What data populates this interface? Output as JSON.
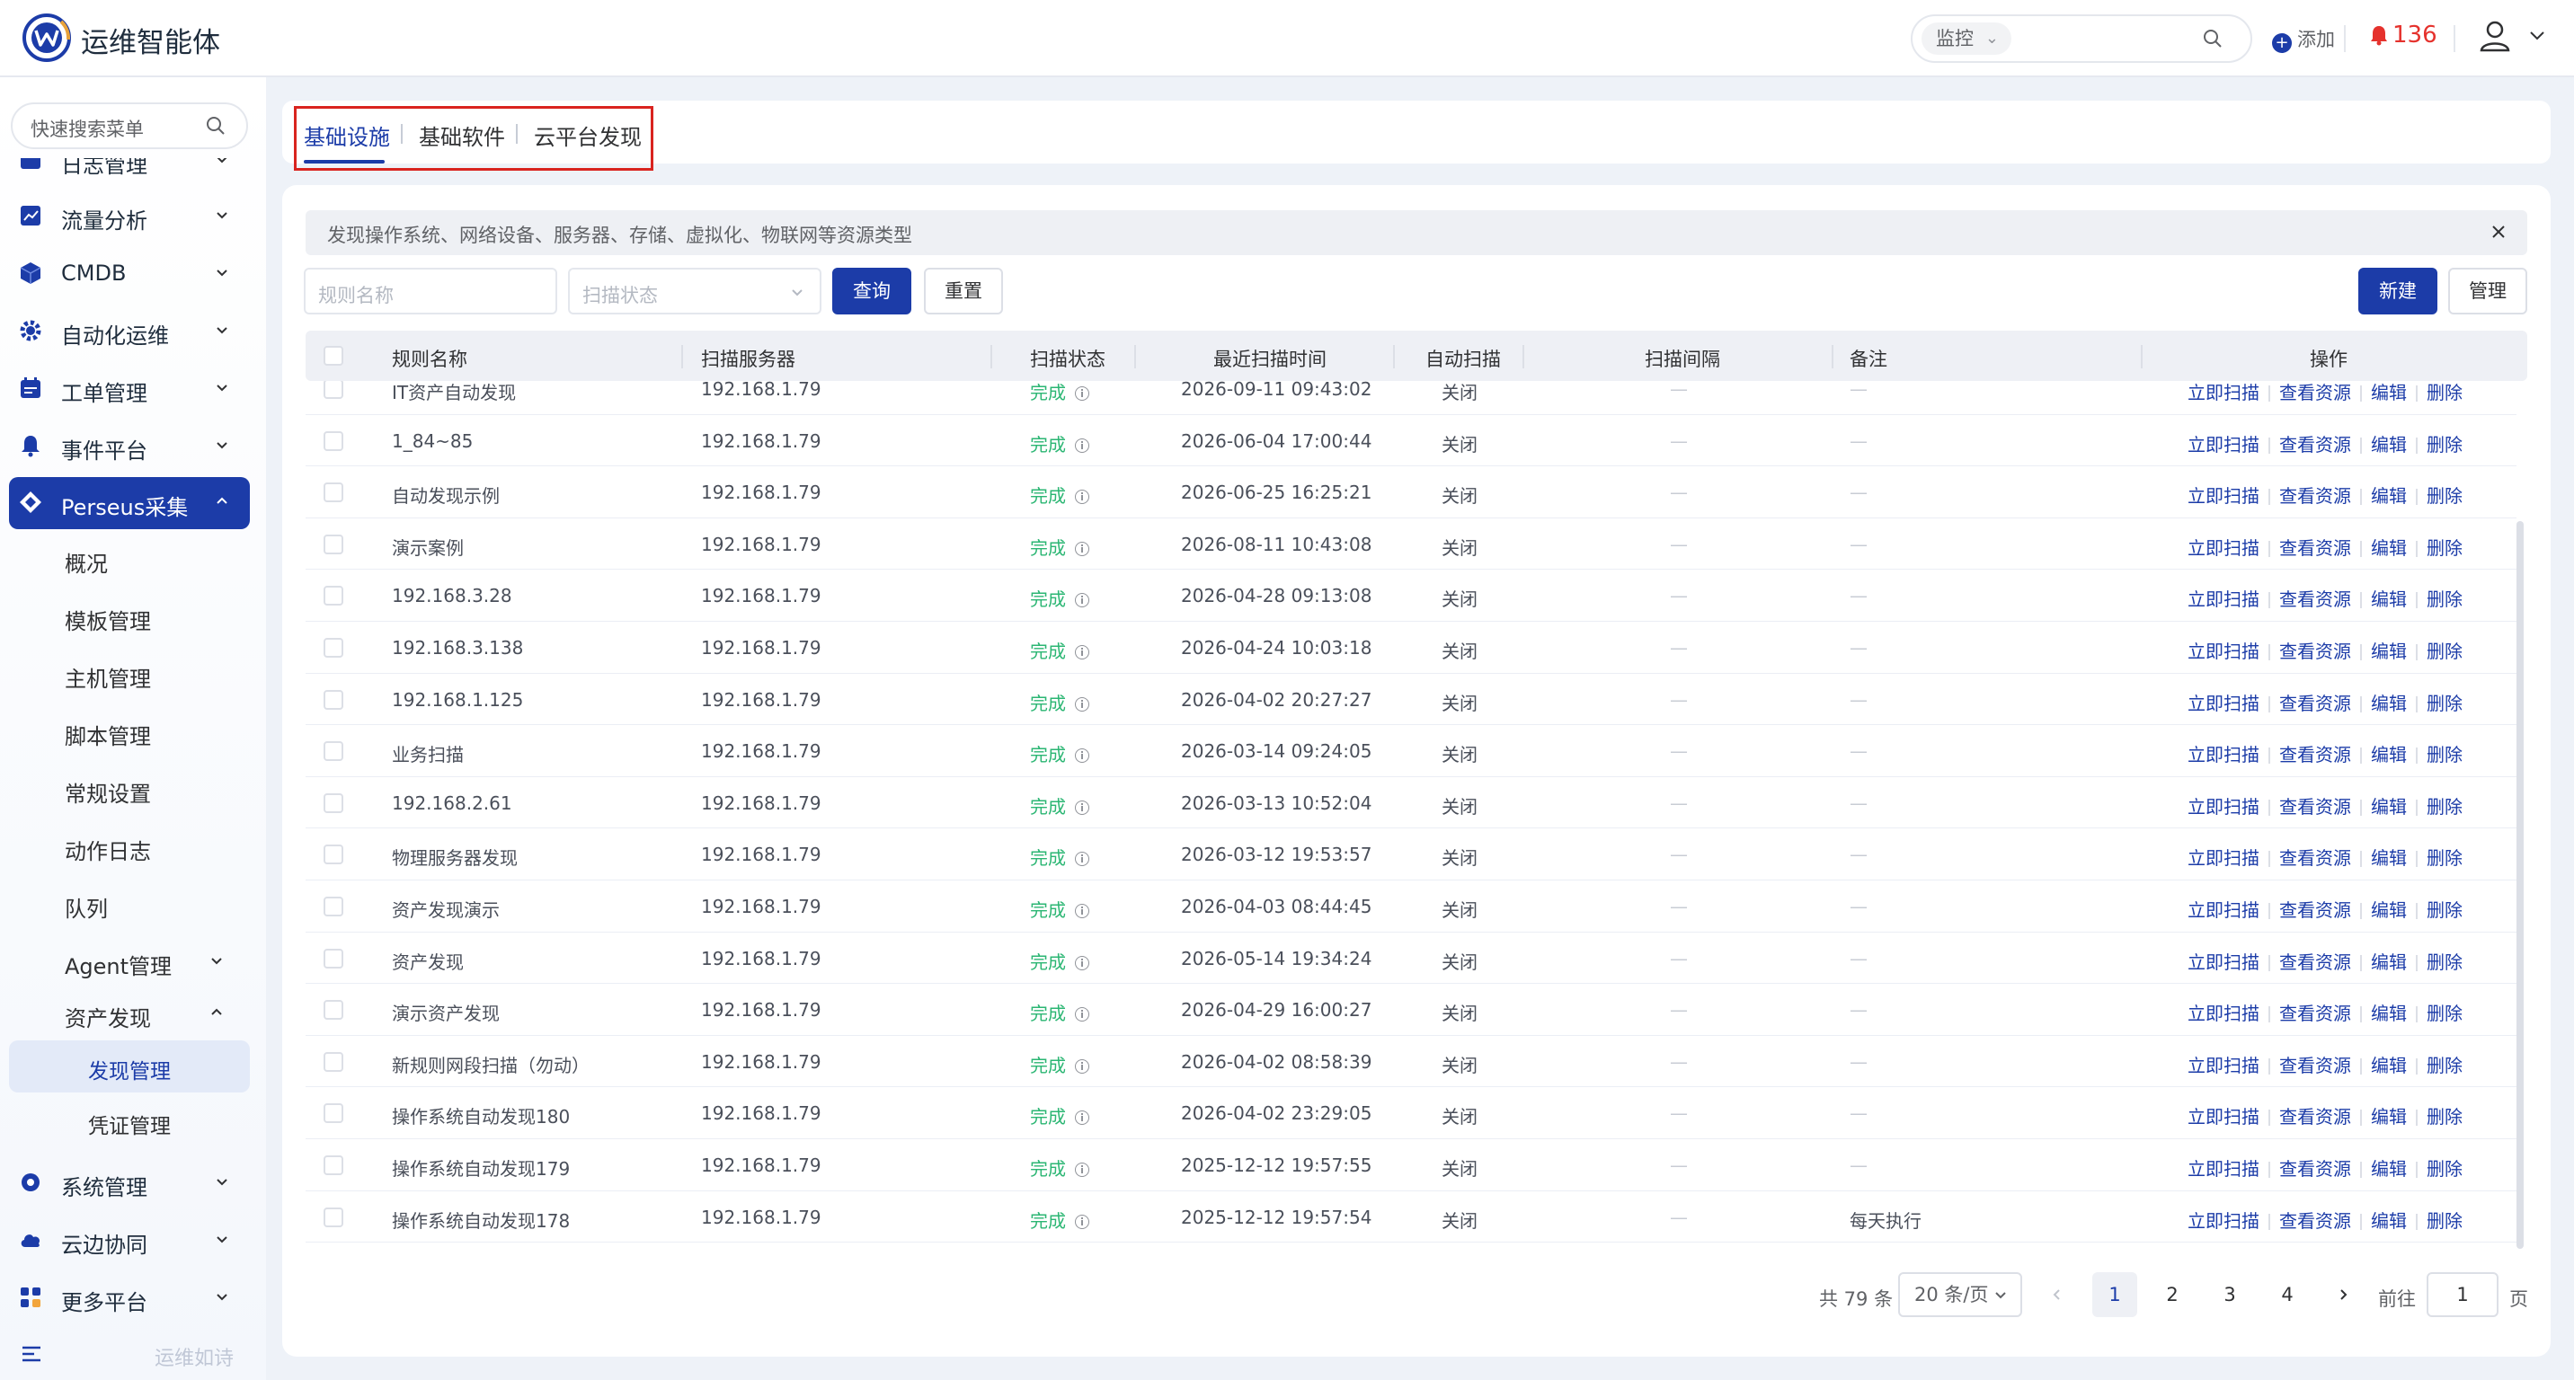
{
  "header": {
    "app_title": "运维智能体",
    "search_scope": "监控",
    "add_label": "添加",
    "alert_count": "136",
    "colors": {
      "accent": "#1c3ca8",
      "alert": "#e5322d",
      "success": "#2bb673"
    }
  },
  "sidebar": {
    "search_placeholder": "快速搜索菜单",
    "items": [
      {
        "label": "日志管理",
        "icon": "log-icon"
      },
      {
        "label": "流量分析",
        "icon": "traffic-chart-icon"
      },
      {
        "label": "CMDB",
        "icon": "cube-icon"
      },
      {
        "label": "自动化运维",
        "icon": "gear-icon"
      },
      {
        "label": "工单管理",
        "icon": "calendar-icon"
      },
      {
        "label": "事件平台",
        "icon": "bell-icon"
      },
      {
        "label": "Perseus采集",
        "icon": "diamond-icon"
      },
      {
        "label": "系统管理",
        "icon": "settings-icon"
      },
      {
        "label": "云边协同",
        "icon": "cloud-icon"
      },
      {
        "label": "更多平台",
        "icon": "grid-icon"
      }
    ],
    "perseus_children": [
      "概况",
      "模板管理",
      "主机管理",
      "脚本管理",
      "常规设置",
      "动作日志",
      "队列",
      "Agent管理",
      "资产发现"
    ],
    "asset_children": [
      "发现管理",
      "凭证管理"
    ],
    "footer_text": "运维如诗"
  },
  "tabs": [
    "基础设施",
    "基础软件",
    "云平台发现"
  ],
  "notice": "发现操作系统、网络设备、服务器、存储、虚拟化、物联网等资源类型",
  "filters": {
    "rule_name_placeholder": "规则名称",
    "scan_status_placeholder": "扫描状态",
    "query_label": "查询",
    "reset_label": "重置",
    "new_label": "新建",
    "manage_label": "管理"
  },
  "table": {
    "columns": [
      "规则名称",
      "扫描服务器",
      "扫描状态",
      "最近扫描时间",
      "自动扫描",
      "扫描间隔",
      "备注",
      "操作"
    ],
    "actions": [
      "立即扫描",
      "查看资源",
      "编辑",
      "删除"
    ],
    "rows": [
      {
        "name": "IT资产自动发现",
        "server": "192.168.1.79",
        "status": "完成",
        "time": "2026-09-11 09:43:02",
        "auto": "关闭",
        "interval": "—",
        "note": "—"
      },
      {
        "name": "1_84~85",
        "server": "192.168.1.79",
        "status": "完成",
        "time": "2026-06-04 17:00:44",
        "auto": "关闭",
        "interval": "—",
        "note": "—"
      },
      {
        "name": "自动发现示例",
        "server": "192.168.1.79",
        "status": "完成",
        "time": "2026-06-25 16:25:21",
        "auto": "关闭",
        "interval": "—",
        "note": "—"
      },
      {
        "name": "演示案例",
        "server": "192.168.1.79",
        "status": "完成",
        "time": "2026-08-11 10:43:08",
        "auto": "关闭",
        "interval": "—",
        "note": "—"
      },
      {
        "name": "192.168.3.28",
        "server": "192.168.1.79",
        "status": "完成",
        "time": "2026-04-28 09:13:08",
        "auto": "关闭",
        "interval": "—",
        "note": "—"
      },
      {
        "name": "192.168.3.138",
        "server": "192.168.1.79",
        "status": "完成",
        "time": "2026-04-24 10:03:18",
        "auto": "关闭",
        "interval": "—",
        "note": "—"
      },
      {
        "name": "192.168.1.125",
        "server": "192.168.1.79",
        "status": "完成",
        "time": "2026-04-02 20:27:27",
        "auto": "关闭",
        "interval": "—",
        "note": "—"
      },
      {
        "name": "业务扫描",
        "server": "192.168.1.79",
        "status": "完成",
        "time": "2026-03-14 09:24:05",
        "auto": "关闭",
        "interval": "—",
        "note": "—"
      },
      {
        "name": "192.168.2.61",
        "server": "192.168.1.79",
        "status": "完成",
        "time": "2026-03-13 10:52:04",
        "auto": "关闭",
        "interval": "—",
        "note": "—"
      },
      {
        "name": "物理服务器发现",
        "server": "192.168.1.79",
        "status": "完成",
        "time": "2026-03-12 19:53:57",
        "auto": "关闭",
        "interval": "—",
        "note": "—"
      },
      {
        "name": "资产发现演示",
        "server": "192.168.1.79",
        "status": "完成",
        "time": "2026-04-03 08:44:45",
        "auto": "关闭",
        "interval": "—",
        "note": "—"
      },
      {
        "name": "资产发现",
        "server": "192.168.1.79",
        "status": "完成",
        "time": "2026-05-14 19:34:24",
        "auto": "关闭",
        "interval": "—",
        "note": "—"
      },
      {
        "name": "演示资产发现",
        "server": "192.168.1.79",
        "status": "完成",
        "time": "2026-04-29 16:00:27",
        "auto": "关闭",
        "interval": "—",
        "note": "—"
      },
      {
        "name": "新规则网段扫描（勿动）",
        "server": "192.168.1.79",
        "status": "完成",
        "time": "2026-04-02 08:58:39",
        "auto": "关闭",
        "interval": "—",
        "note": "—"
      },
      {
        "name": "操作系统自动发现180",
        "server": "192.168.1.79",
        "status": "完成",
        "time": "2026-04-02 23:29:05",
        "auto": "关闭",
        "interval": "—",
        "note": "—"
      },
      {
        "name": "操作系统自动发现179",
        "server": "192.168.1.79",
        "status": "完成",
        "time": "2025-12-12 19:57:55",
        "auto": "关闭",
        "interval": "—",
        "note": "—"
      },
      {
        "name": "操作系统自动发现178",
        "server": "192.168.1.79",
        "status": "完成",
        "time": "2025-12-12 19:57:54",
        "auto": "关闭",
        "interval": "—",
        "note": "每天执行"
      }
    ]
  },
  "pagination": {
    "total": "共 79 条",
    "page_size": "20 条/页",
    "pages": [
      "1",
      "2",
      "3",
      "4"
    ],
    "current": "1",
    "goto_label": "前往",
    "goto_value": "1",
    "page_suffix": "页"
  }
}
